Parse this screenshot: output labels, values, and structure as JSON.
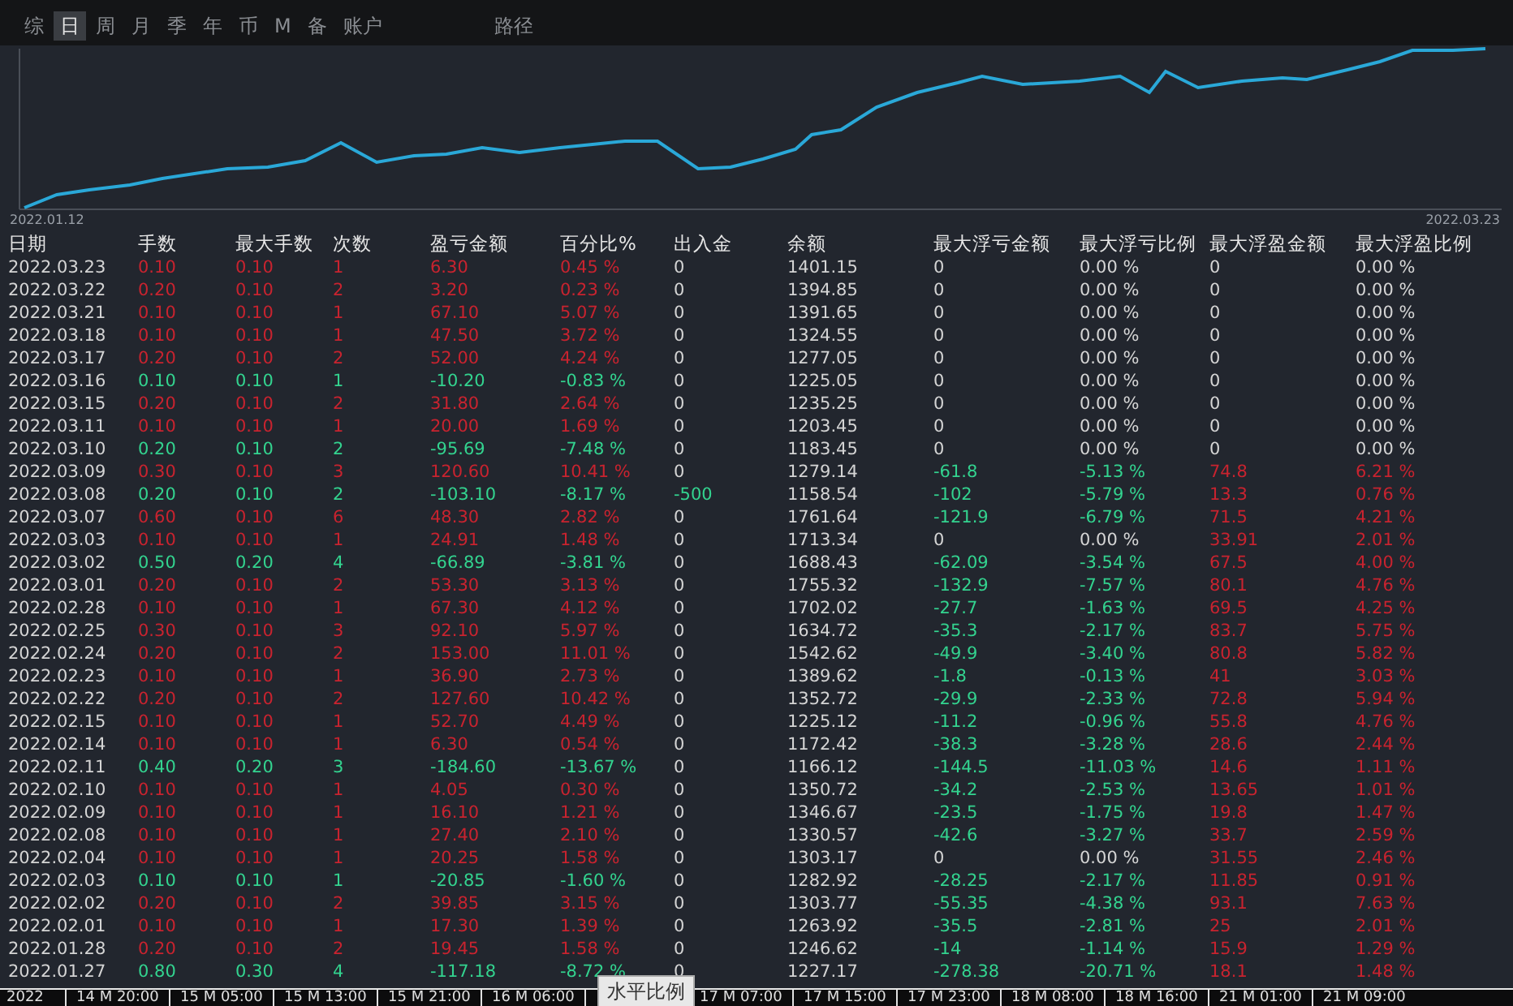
{
  "tabs": [
    {
      "label": "综",
      "selected": false
    },
    {
      "label": "日",
      "selected": true
    },
    {
      "label": "周",
      "selected": false
    },
    {
      "label": "月",
      "selected": false
    },
    {
      "label": "季",
      "selected": false
    },
    {
      "label": "年",
      "selected": false
    },
    {
      "label": "币",
      "selected": false
    },
    {
      "label": "M",
      "selected": false
    },
    {
      "label": "备",
      "selected": false
    },
    {
      "label": "账户",
      "selected": false
    }
  ],
  "path_tab": "路径",
  "chart": {
    "start_date": "2022.01.12",
    "end_date": "2022.03.23"
  },
  "table": {
    "columns": [
      "日期",
      "手数",
      "最大手数",
      "次数",
      "盈亏金额",
      "百分比%",
      "出入金",
      "余额",
      "最大浮亏金额",
      "最大浮亏比例",
      "最大浮盈金额",
      "最大浮盈比例"
    ],
    "rows": [
      {
        "kind": "gain",
        "flow_out": false,
        "float_loss": false,
        "float_profit": false,
        "cells": [
          "2022.03.23",
          "0.10",
          "0.10",
          "1",
          "6.30",
          "0.45 %",
          "0",
          "1401.15",
          "0",
          "0.00 %",
          "0",
          "0.00 %"
        ]
      },
      {
        "kind": "gain",
        "flow_out": false,
        "float_loss": false,
        "float_profit": false,
        "cells": [
          "2022.03.22",
          "0.20",
          "0.10",
          "2",
          "3.20",
          "0.23 %",
          "0",
          "1394.85",
          "0",
          "0.00 %",
          "0",
          "0.00 %"
        ]
      },
      {
        "kind": "gain",
        "flow_out": false,
        "float_loss": false,
        "float_profit": false,
        "cells": [
          "2022.03.21",
          "0.10",
          "0.10",
          "1",
          "67.10",
          "5.07 %",
          "0",
          "1391.65",
          "0",
          "0.00 %",
          "0",
          "0.00 %"
        ]
      },
      {
        "kind": "gain",
        "flow_out": false,
        "float_loss": false,
        "float_profit": false,
        "cells": [
          "2022.03.18",
          "0.10",
          "0.10",
          "1",
          "47.50",
          "3.72 %",
          "0",
          "1324.55",
          "0",
          "0.00 %",
          "0",
          "0.00 %"
        ]
      },
      {
        "kind": "gain",
        "flow_out": false,
        "float_loss": false,
        "float_profit": false,
        "cells": [
          "2022.03.17",
          "0.20",
          "0.10",
          "2",
          "52.00",
          "4.24 %",
          "0",
          "1277.05",
          "0",
          "0.00 %",
          "0",
          "0.00 %"
        ]
      },
      {
        "kind": "loss",
        "flow_out": false,
        "float_loss": false,
        "float_profit": false,
        "cells": [
          "2022.03.16",
          "0.10",
          "0.10",
          "1",
          "-10.20",
          "-0.83 %",
          "0",
          "1225.05",
          "0",
          "0.00 %",
          "0",
          "0.00 %"
        ]
      },
      {
        "kind": "gain",
        "flow_out": false,
        "float_loss": false,
        "float_profit": false,
        "cells": [
          "2022.03.15",
          "0.20",
          "0.10",
          "2",
          "31.80",
          "2.64 %",
          "0",
          "1235.25",
          "0",
          "0.00 %",
          "0",
          "0.00 %"
        ]
      },
      {
        "kind": "gain",
        "flow_out": false,
        "float_loss": false,
        "float_profit": false,
        "cells": [
          "2022.03.11",
          "0.10",
          "0.10",
          "1",
          "20.00",
          "1.69 %",
          "0",
          "1203.45",
          "0",
          "0.00 %",
          "0",
          "0.00 %"
        ]
      },
      {
        "kind": "loss",
        "flow_out": false,
        "float_loss": false,
        "float_profit": false,
        "cells": [
          "2022.03.10",
          "0.20",
          "0.10",
          "2",
          "-95.69",
          "-7.48 %",
          "0",
          "1183.45",
          "0",
          "0.00 %",
          "0",
          "0.00 %"
        ]
      },
      {
        "kind": "gain",
        "flow_out": false,
        "float_loss": true,
        "float_profit": true,
        "cells": [
          "2022.03.09",
          "0.30",
          "0.10",
          "3",
          "120.60",
          "10.41 %",
          "0",
          "1279.14",
          "-61.8",
          "-5.13 %",
          "74.8",
          "6.21 %"
        ]
      },
      {
        "kind": "loss",
        "flow_out": true,
        "float_loss": true,
        "float_profit": true,
        "cells": [
          "2022.03.08",
          "0.20",
          "0.10",
          "2",
          "-103.10",
          "-8.17 %",
          "-500",
          "1158.54",
          "-102",
          "-5.79 %",
          "13.3",
          "0.76 %"
        ]
      },
      {
        "kind": "gain",
        "flow_out": false,
        "float_loss": true,
        "float_profit": true,
        "cells": [
          "2022.03.07",
          "0.60",
          "0.10",
          "6",
          "48.30",
          "2.82 %",
          "0",
          "1761.64",
          "-121.9",
          "-6.79 %",
          "71.5",
          "4.21 %"
        ]
      },
      {
        "kind": "gain",
        "flow_out": false,
        "float_loss": false,
        "float_profit": true,
        "cells": [
          "2022.03.03",
          "0.10",
          "0.10",
          "1",
          "24.91",
          "1.48 %",
          "0",
          "1713.34",
          "0",
          "0.00 %",
          "33.91",
          "2.01 %"
        ]
      },
      {
        "kind": "loss",
        "flow_out": false,
        "float_loss": true,
        "float_profit": true,
        "cells": [
          "2022.03.02",
          "0.50",
          "0.20",
          "4",
          "-66.89",
          "-3.81 %",
          "0",
          "1688.43",
          "-62.09",
          "-3.54 %",
          "67.5",
          "4.00 %"
        ]
      },
      {
        "kind": "gain",
        "flow_out": false,
        "float_loss": true,
        "float_profit": true,
        "cells": [
          "2022.03.01",
          "0.20",
          "0.10",
          "2",
          "53.30",
          "3.13 %",
          "0",
          "1755.32",
          "-132.9",
          "-7.57 %",
          "80.1",
          "4.76 %"
        ]
      },
      {
        "kind": "gain",
        "flow_out": false,
        "float_loss": true,
        "float_profit": true,
        "cells": [
          "2022.02.28",
          "0.10",
          "0.10",
          "1",
          "67.30",
          "4.12 %",
          "0",
          "1702.02",
          "-27.7",
          "-1.63 %",
          "69.5",
          "4.25 %"
        ]
      },
      {
        "kind": "gain",
        "flow_out": false,
        "float_loss": true,
        "float_profit": true,
        "cells": [
          "2022.02.25",
          "0.30",
          "0.10",
          "3",
          "92.10",
          "5.97 %",
          "0",
          "1634.72",
          "-35.3",
          "-2.17 %",
          "83.7",
          "5.75 %"
        ]
      },
      {
        "kind": "gain",
        "flow_out": false,
        "float_loss": true,
        "float_profit": true,
        "cells": [
          "2022.02.24",
          "0.20",
          "0.10",
          "2",
          "153.00",
          "11.01 %",
          "0",
          "1542.62",
          "-49.9",
          "-3.40 %",
          "80.8",
          "5.82 %"
        ]
      },
      {
        "kind": "gain",
        "flow_out": false,
        "float_loss": true,
        "float_profit": true,
        "cells": [
          "2022.02.23",
          "0.10",
          "0.10",
          "1",
          "36.90",
          "2.73 %",
          "0",
          "1389.62",
          "-1.8",
          "-0.13 %",
          "41",
          "3.03 %"
        ]
      },
      {
        "kind": "gain",
        "flow_out": false,
        "float_loss": true,
        "float_profit": true,
        "cells": [
          "2022.02.22",
          "0.20",
          "0.10",
          "2",
          "127.60",
          "10.42 %",
          "0",
          "1352.72",
          "-29.9",
          "-2.33 %",
          "72.8",
          "5.94 %"
        ]
      },
      {
        "kind": "gain",
        "flow_out": false,
        "float_loss": true,
        "float_profit": true,
        "cells": [
          "2022.02.15",
          "0.10",
          "0.10",
          "1",
          "52.70",
          "4.49 %",
          "0",
          "1225.12",
          "-11.2",
          "-0.96 %",
          "55.8",
          "4.76 %"
        ]
      },
      {
        "kind": "gain",
        "flow_out": false,
        "float_loss": true,
        "float_profit": true,
        "cells": [
          "2022.02.14",
          "0.10",
          "0.10",
          "1",
          "6.30",
          "0.54 %",
          "0",
          "1172.42",
          "-38.3",
          "-3.28 %",
          "28.6",
          "2.44 %"
        ]
      },
      {
        "kind": "loss",
        "flow_out": false,
        "float_loss": true,
        "float_profit": true,
        "cells": [
          "2022.02.11",
          "0.40",
          "0.20",
          "3",
          "-184.60",
          "-13.67 %",
          "0",
          "1166.12",
          "-144.5",
          "-11.03 %",
          "14.6",
          "1.11 %"
        ]
      },
      {
        "kind": "gain",
        "flow_out": false,
        "float_loss": true,
        "float_profit": true,
        "cells": [
          "2022.02.10",
          "0.10",
          "0.10",
          "1",
          "4.05",
          "0.30 %",
          "0",
          "1350.72",
          "-34.2",
          "-2.53 %",
          "13.65",
          "1.01 %"
        ]
      },
      {
        "kind": "gain",
        "flow_out": false,
        "float_loss": true,
        "float_profit": true,
        "cells": [
          "2022.02.09",
          "0.10",
          "0.10",
          "1",
          "16.10",
          "1.21 %",
          "0",
          "1346.67",
          "-23.5",
          "-1.75 %",
          "19.8",
          "1.47 %"
        ]
      },
      {
        "kind": "gain",
        "flow_out": false,
        "float_loss": true,
        "float_profit": true,
        "cells": [
          "2022.02.08",
          "0.10",
          "0.10",
          "1",
          "27.40",
          "2.10 %",
          "0",
          "1330.57",
          "-42.6",
          "-3.27 %",
          "33.7",
          "2.59 %"
        ]
      },
      {
        "kind": "gain",
        "flow_out": false,
        "float_loss": false,
        "float_profit": true,
        "cells": [
          "2022.02.04",
          "0.10",
          "0.10",
          "1",
          "20.25",
          "1.58 %",
          "0",
          "1303.17",
          "0",
          "0.00 %",
          "31.55",
          "2.46 %"
        ]
      },
      {
        "kind": "loss",
        "flow_out": false,
        "float_loss": true,
        "float_profit": true,
        "cells": [
          "2022.02.03",
          "0.10",
          "0.10",
          "1",
          "-20.85",
          "-1.60 %",
          "0",
          "1282.92",
          "-28.25",
          "-2.17 %",
          "11.85",
          "0.91 %"
        ]
      },
      {
        "kind": "gain",
        "flow_out": false,
        "float_loss": true,
        "float_profit": true,
        "cells": [
          "2022.02.02",
          "0.20",
          "0.10",
          "2",
          "39.85",
          "3.15 %",
          "0",
          "1303.77",
          "-55.35",
          "-4.38 %",
          "93.1",
          "7.63 %"
        ]
      },
      {
        "kind": "gain",
        "flow_out": false,
        "float_loss": true,
        "float_profit": true,
        "cells": [
          "2022.02.01",
          "0.10",
          "0.10",
          "1",
          "17.30",
          "1.39 %",
          "0",
          "1263.92",
          "-35.5",
          "-2.81 %",
          "25",
          "2.01 %"
        ]
      },
      {
        "kind": "gain",
        "flow_out": false,
        "float_loss": true,
        "float_profit": true,
        "cells": [
          "2022.01.28",
          "0.20",
          "0.10",
          "2",
          "19.45",
          "1.58 %",
          "0",
          "1246.62",
          "-14",
          "-1.14 %",
          "15.9",
          "1.29 %"
        ]
      },
      {
        "kind": "loss",
        "flow_out": false,
        "float_loss": true,
        "float_profit": true,
        "cells": [
          "2022.01.27",
          "0.80",
          "0.30",
          "4",
          "-117.18",
          "-8.72 %",
          "0",
          "1227.17",
          "-278.38",
          "-20.71 %",
          "18.1",
          "1.48 %"
        ]
      }
    ]
  },
  "time_axis": {
    "start": "2022",
    "labels": [
      "14 M 20:00",
      "15 M 05:00",
      "15 M 13:00",
      "15 M 21:00",
      "16 M 06:00",
      "17 M 07:00",
      "17 M 15:00",
      "17 M 23:00",
      "18 M 08:00",
      "18 M 16:00",
      "21 M 01:00",
      "21 M 09:00"
    ]
  },
  "tooltip": "水平比例"
}
